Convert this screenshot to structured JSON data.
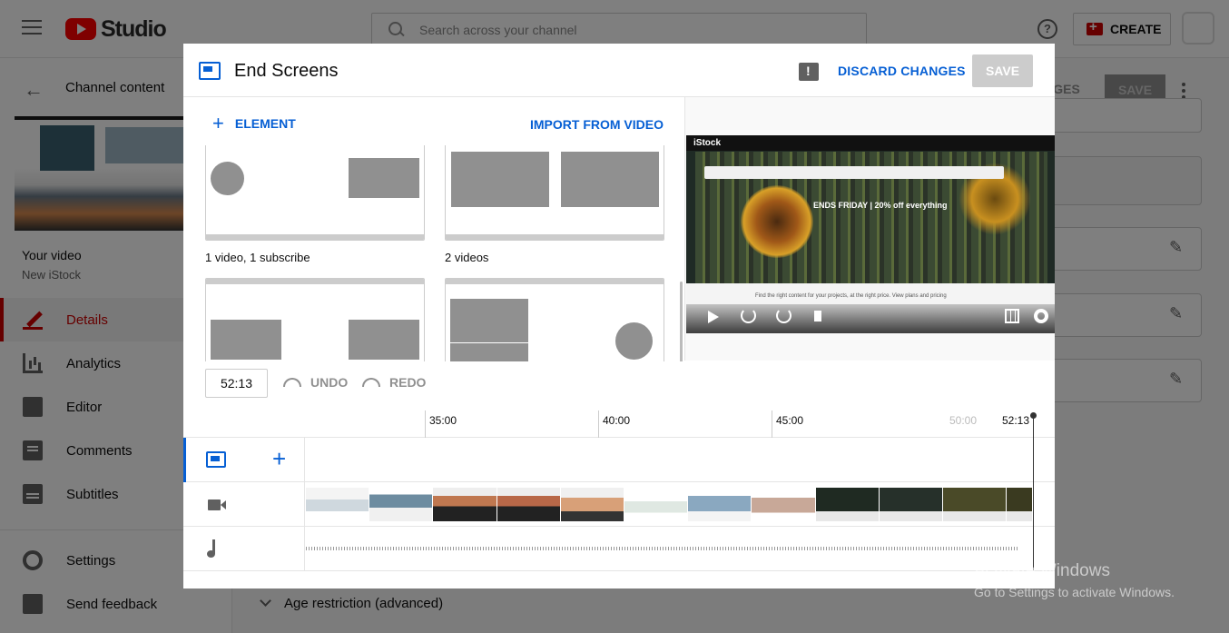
{
  "app": {
    "logo_text": "Studio",
    "search_placeholder": "Search across your channel",
    "create_label": "CREATE",
    "help_icon": "help-circle-icon"
  },
  "sidebar": {
    "back_label": "Channel content",
    "your_video_label": "Your video",
    "video_title": "New iStock",
    "items": [
      {
        "label": "Details",
        "icon": "pencil-icon",
        "active": true
      },
      {
        "label": "Analytics",
        "icon": "analytics-icon",
        "active": false
      },
      {
        "label": "Editor",
        "icon": "clapperboard-icon",
        "active": false
      },
      {
        "label": "Comments",
        "icon": "comment-icon",
        "active": false
      },
      {
        "label": "Subtitles",
        "icon": "subtitles-icon",
        "active": false
      }
    ],
    "bottom_items": [
      {
        "label": "Settings",
        "icon": "gear-icon"
      },
      {
        "label": "Send feedback",
        "icon": "feedback-icon"
      }
    ]
  },
  "background_page": {
    "changes_label": "ANGES",
    "save_label": "SAVE",
    "age_restriction": "Age restriction (advanced)"
  },
  "modal": {
    "title": "End Screens",
    "discard_label": "DISCARD CHANGES",
    "save_label": "SAVE",
    "element_label": "ELEMENT",
    "import_label": "IMPORT FROM VIDEO",
    "templates": [
      {
        "label": "1 video, 1 subscribe"
      },
      {
        "label": "2 videos"
      },
      {
        "label": ""
      },
      {
        "label": ""
      }
    ],
    "time_value": "52:13",
    "undo_label": "UNDO",
    "redo_label": "REDO",
    "ruler_ticks": [
      "35:00",
      "40:00",
      "45:00",
      "50:00",
      "52:13"
    ],
    "preview": {
      "brand": "iStock",
      "promo": "ENDS FRIDAY | 20% off everything",
      "footer": "Find the right content for your projects, at the right price. View plans and pricing"
    }
  },
  "watermark": {
    "line1": "Activate Windows",
    "line2": "Go to Settings to activate Windows."
  },
  "colors": {
    "accent_blue": "#065fd4",
    "brand_red": "#ff0000",
    "active_red": "#cc0000"
  }
}
